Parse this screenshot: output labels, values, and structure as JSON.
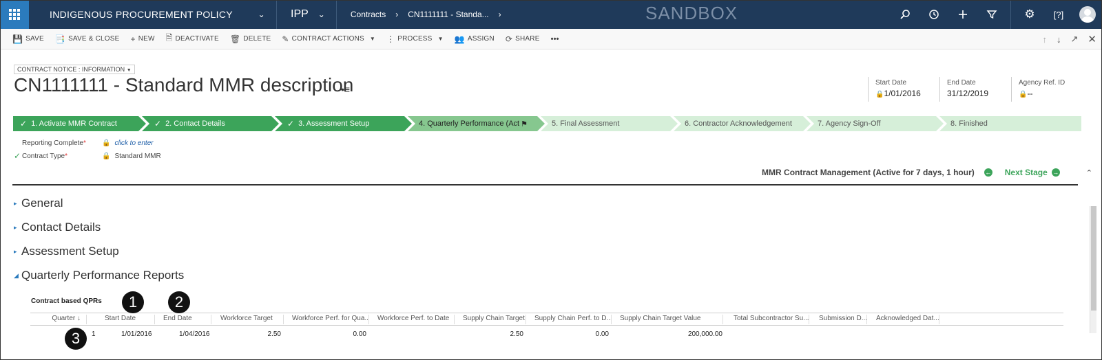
{
  "topnav": {
    "app_name": "INDIGENOUS PROCUREMENT POLICY",
    "app_abbrev": "IPP",
    "breadcrumb_1": "Contracts",
    "breadcrumb_2": "CN1111111 - Standa...",
    "environment": "SANDBOX",
    "icons": [
      "search-icon",
      "history-icon",
      "plus-icon",
      "filter-icon",
      "gear-icon",
      "help-icon",
      "avatar"
    ]
  },
  "commands": [
    {
      "label": "SAVE",
      "icon": "save-icon"
    },
    {
      "label": "SAVE & CLOSE",
      "icon": "save-close-icon"
    },
    {
      "label": "NEW",
      "icon": "plus-icon"
    },
    {
      "label": "DEACTIVATE",
      "icon": "deactivate-icon"
    },
    {
      "label": "DELETE",
      "icon": "trash-icon"
    },
    {
      "label": "CONTRACT ACTIONS",
      "icon": "actions-icon",
      "dropdown": true
    },
    {
      "label": "PROCESS",
      "icon": "process-icon",
      "dropdown": true
    },
    {
      "label": "ASSIGN",
      "icon": "assign-icon"
    },
    {
      "label": "SHARE",
      "icon": "share-icon"
    },
    {
      "label": "•••",
      "icon": "more-icon"
    }
  ],
  "header": {
    "form_selector": "CONTRACT NOTICE : INFORMATION",
    "title": "CN1111111 - Standard MMR description",
    "fields": [
      {
        "label": "Start Date",
        "value": "1/01/2016",
        "locked": true
      },
      {
        "label": "End Date",
        "value": "31/12/2019",
        "locked": false
      },
      {
        "label": "Agency Ref. ID",
        "value": "--",
        "locked": true
      }
    ]
  },
  "process": {
    "stages": [
      {
        "label": "1. Activate MMR Contract",
        "status": "done"
      },
      {
        "label": "2. Contact Details",
        "status": "done"
      },
      {
        "label": "3. Assessment Setup",
        "status": "done"
      },
      {
        "label": "4. Quarterly Performance (Act",
        "status": "active"
      },
      {
        "label": "5. Final Assessment",
        "status": "future"
      },
      {
        "label": "6. Contractor Acknowledgement",
        "status": "future"
      },
      {
        "label": "7. Agency Sign-Off",
        "status": "future"
      },
      {
        "label": "8. Finished",
        "status": "future"
      }
    ],
    "fields": [
      {
        "label": "Reporting Complete",
        "value": "click to enter",
        "completed": false
      },
      {
        "label": "Contract Type",
        "value": "Standard MMR",
        "completed": true
      }
    ],
    "active_info": "MMR Contract Management (Active for 7 days, 1 hour)",
    "next_stage": "Next Stage"
  },
  "sections": [
    {
      "label": "General",
      "expanded": false
    },
    {
      "label": "Contact Details",
      "expanded": false
    },
    {
      "label": "Assessment Setup",
      "expanded": false
    },
    {
      "label": "Quarterly Performance Reports",
      "expanded": true
    }
  ],
  "subgrid": {
    "title": "Contract based QPRs",
    "columns": [
      "Quarter ↓",
      "Start Date",
      "End Date",
      "Workforce Target",
      "Workforce Perf. for Qua...",
      "Workforce Perf. to Date",
      "Supply Chain Target",
      "Supply Chain Perf. to D...",
      "Supply Chain Target Value",
      "Total Subcontractor Su...",
      "Submission D...",
      "Acknowledged Dat..."
    ],
    "rows": [
      [
        "1",
        "1/01/2016",
        "1/04/2016",
        "2.50",
        "0.00",
        "",
        "2.50",
        "0.00",
        "200,000.00",
        "",
        "",
        ""
      ]
    ]
  },
  "callouts": [
    "1",
    "2",
    "3"
  ],
  "colors": {
    "nav": "#1f3a5a",
    "waffle": "#2b7bbd",
    "stage_done": "#3ca45a",
    "stage_active": "#86c78f",
    "stage_future": "#d6efd9"
  }
}
